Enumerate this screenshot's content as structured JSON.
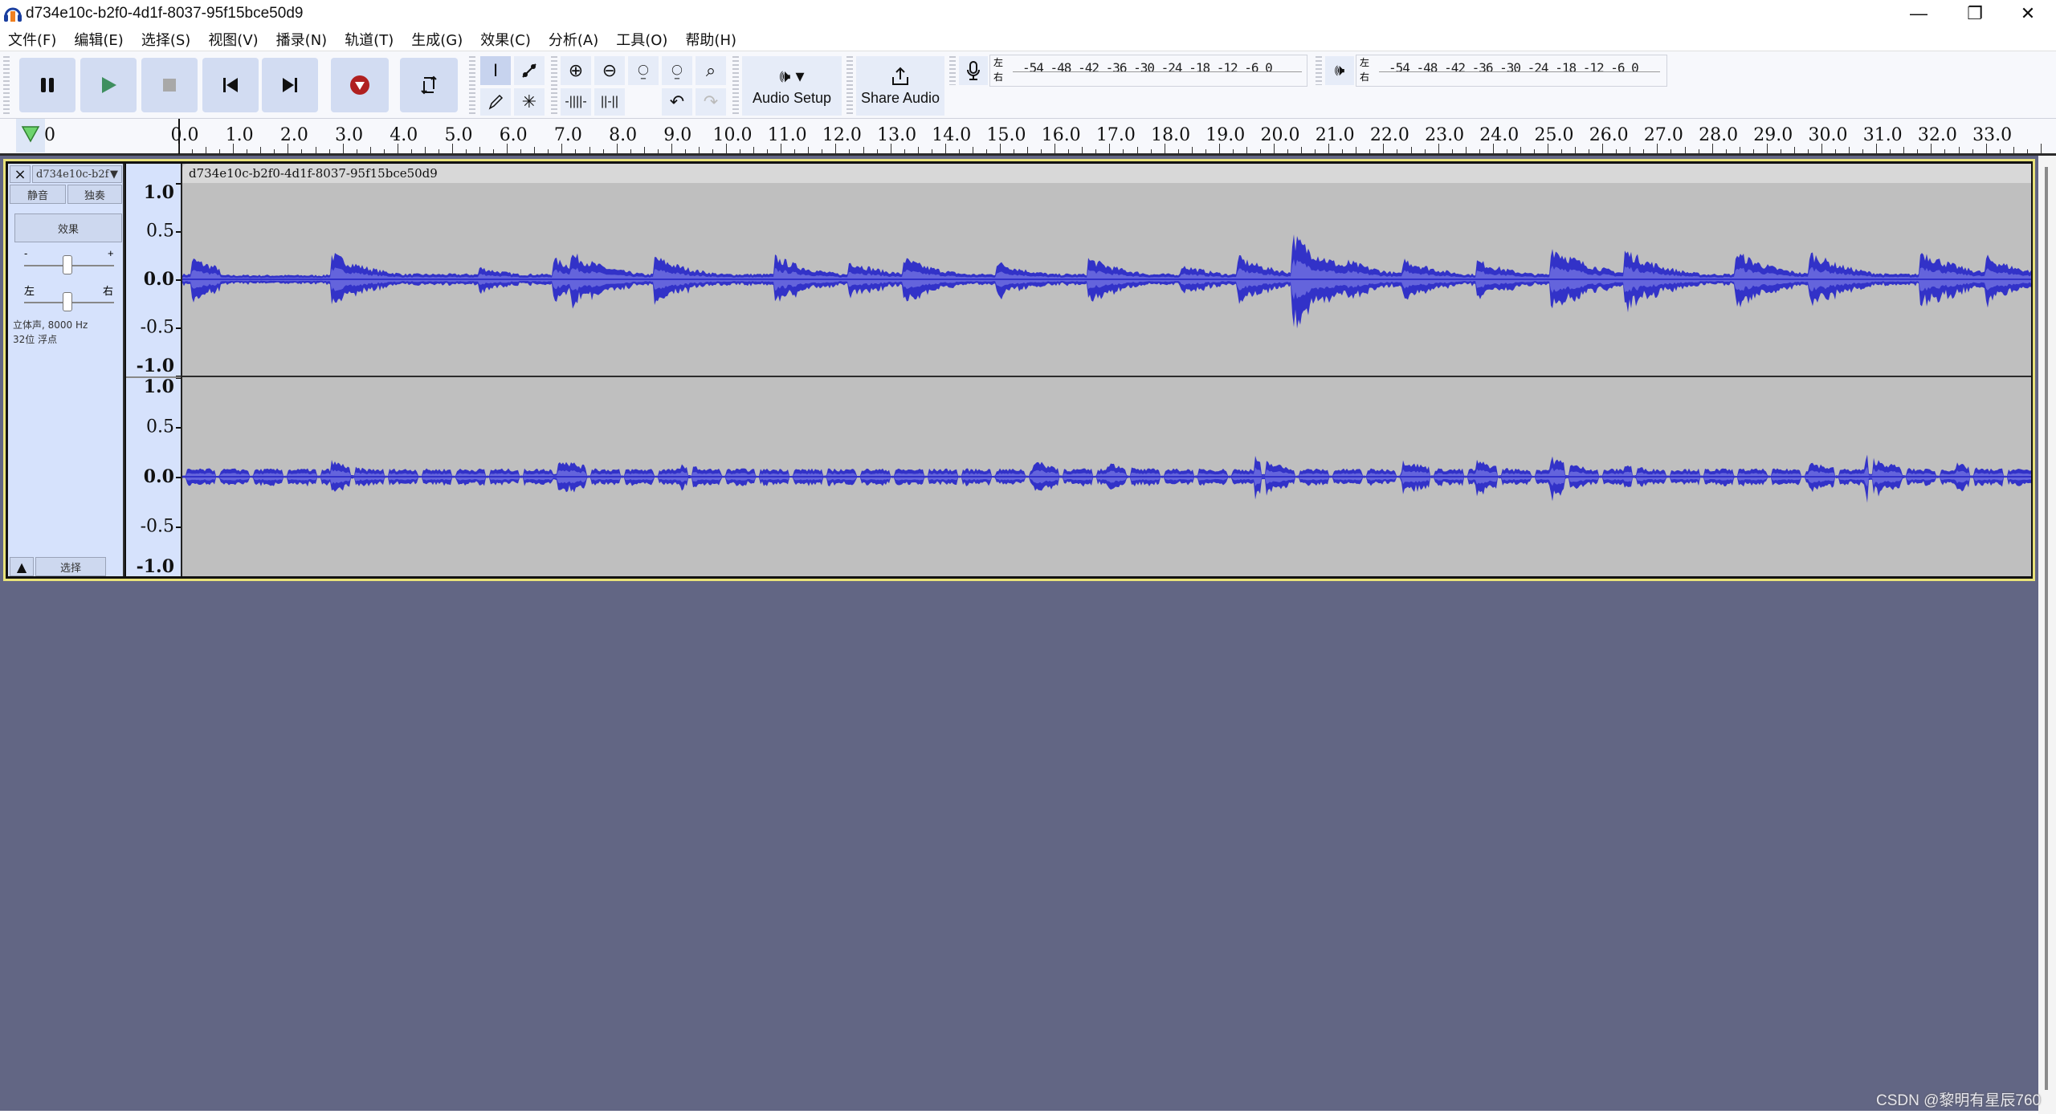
{
  "window": {
    "title": "d734e10c-b2f0-4d1f-8037-95f15bce50d9",
    "controls": {
      "minimize": "—",
      "restore": "❐",
      "close": "✕"
    }
  },
  "menu": [
    {
      "label": "文件(F)"
    },
    {
      "label": "编辑(E)"
    },
    {
      "label": "选择(S)"
    },
    {
      "label": "视图(V)"
    },
    {
      "label": "播录(N)"
    },
    {
      "label": "轨道(T)"
    },
    {
      "label": "生成(G)"
    },
    {
      "label": "效果(C)"
    },
    {
      "label": "分析(A)"
    },
    {
      "label": "工具(O)"
    },
    {
      "label": "帮助(H)"
    }
  ],
  "transport": {
    "pause": "pause-icon",
    "play": "play-icon",
    "stop": "stop-icon",
    "skip_start": "skip-to-start-icon",
    "skip_end": "skip-to-end-icon",
    "record": "record-icon",
    "loop": "loop-icon",
    "colors": {
      "play": "#3f8f5f",
      "record": "#b02020",
      "stop": "#a8a8a8"
    }
  },
  "tools": {
    "selection_active": true
  },
  "audio_setup": {
    "label": "Audio Setup"
  },
  "share_audio": {
    "label": "Share Audio"
  },
  "recording_meter": {
    "left_label": "左",
    "right_label": "右",
    "ticks": "-54 -48 -42 -36 -30 -24 -18 -12 -6 0"
  },
  "playback_meter": {
    "left_label": "左",
    "right_label": "右",
    "ticks": "-54 -48 -42 -36 -30 -24 -18 -12 -6 0"
  },
  "timeline": {
    "start_label": "0",
    "labels": [
      "0.0",
      "1.0",
      "2.0",
      "3.0",
      "4.0",
      "5.0",
      "6.0",
      "7.0",
      "8.0",
      "9.0",
      "10.0",
      "11.0",
      "12.0",
      "13.0",
      "14.0",
      "15.0",
      "16.0",
      "17.0",
      "18.0",
      "19.0",
      "20.0",
      "21.0",
      "22.0",
      "23.0",
      "24.0",
      "25.0",
      "26.0",
      "27.0",
      "28.0",
      "29.0",
      "30.0",
      "31.0",
      "32.0",
      "33.0"
    ]
  },
  "track": {
    "name": "d734e10c-b2f",
    "close": "×",
    "mute": "静音",
    "solo": "独奏",
    "effects": "效果",
    "gain_minus": "-",
    "gain_plus": "+",
    "pan_left": "左",
    "pan_right": "右",
    "info_line1": "立体声, 8000 Hz",
    "info_line2": "32位 浮点",
    "select": "选择",
    "collapse": "▲",
    "gain_level": 0.5,
    "pan_level": 0.5,
    "clip_title": "d734e10c-b2f0-4d1f-8037-95f15bce50d9",
    "vscale": [
      "1.0",
      "0.5",
      "0.0",
      "-0.5",
      "-1.0"
    ],
    "waveform_color": "#3232c8",
    "waveform_rms_color": "#6464dc"
  },
  "watermark": "CSDN @黎明有星辰760"
}
